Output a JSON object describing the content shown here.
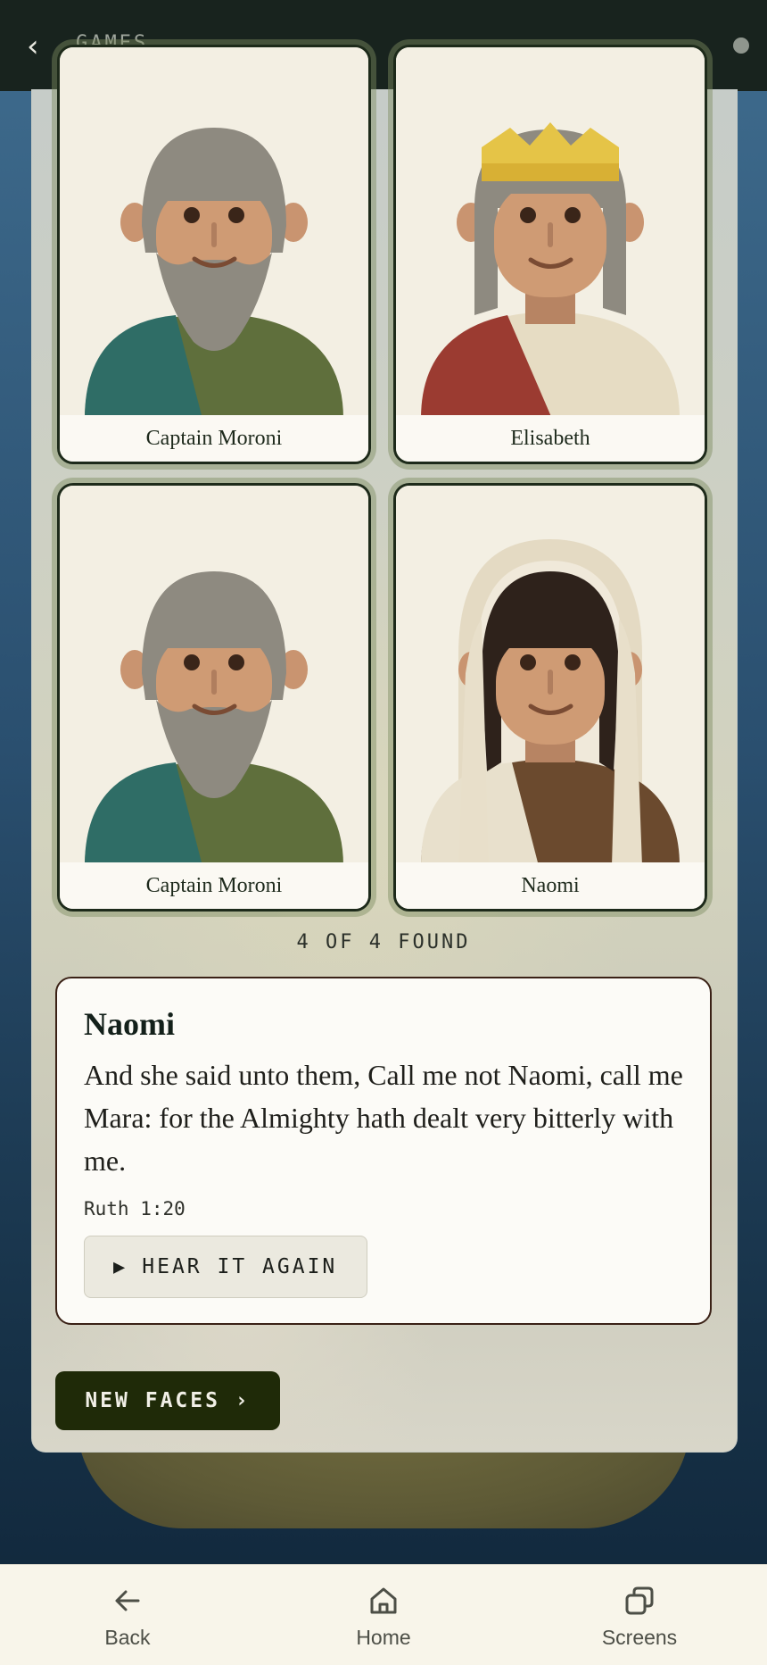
{
  "topbar": {
    "title": "GAMES"
  },
  "cards": [
    {
      "name": "Captain Moroni"
    },
    {
      "name": "Elisabeth"
    },
    {
      "name": "Captain Moroni"
    },
    {
      "name": "Naomi"
    }
  ],
  "status": {
    "found_text": "4 OF 4 FOUND"
  },
  "quote": {
    "name": "Naomi",
    "text": "And she said unto them, Call me not Naomi, call me Mara: for the Almighty hath dealt very bitterly with me.",
    "reference": "Ruth 1:20",
    "hear_again_label": "HEAR IT AGAIN",
    "play_glyph": "▶"
  },
  "actions": {
    "new_faces_label": "NEW FACES ›"
  },
  "navbar": {
    "back_label": "Back",
    "home_label": "Home",
    "screens_label": "Screens"
  },
  "icons": {
    "back_chevron": "‹"
  },
  "colors": {
    "header_bg": "#18231e",
    "card_border": "#1d2a1a",
    "primary_button": "#1f2a08",
    "quote_border": "#3a2116"
  }
}
